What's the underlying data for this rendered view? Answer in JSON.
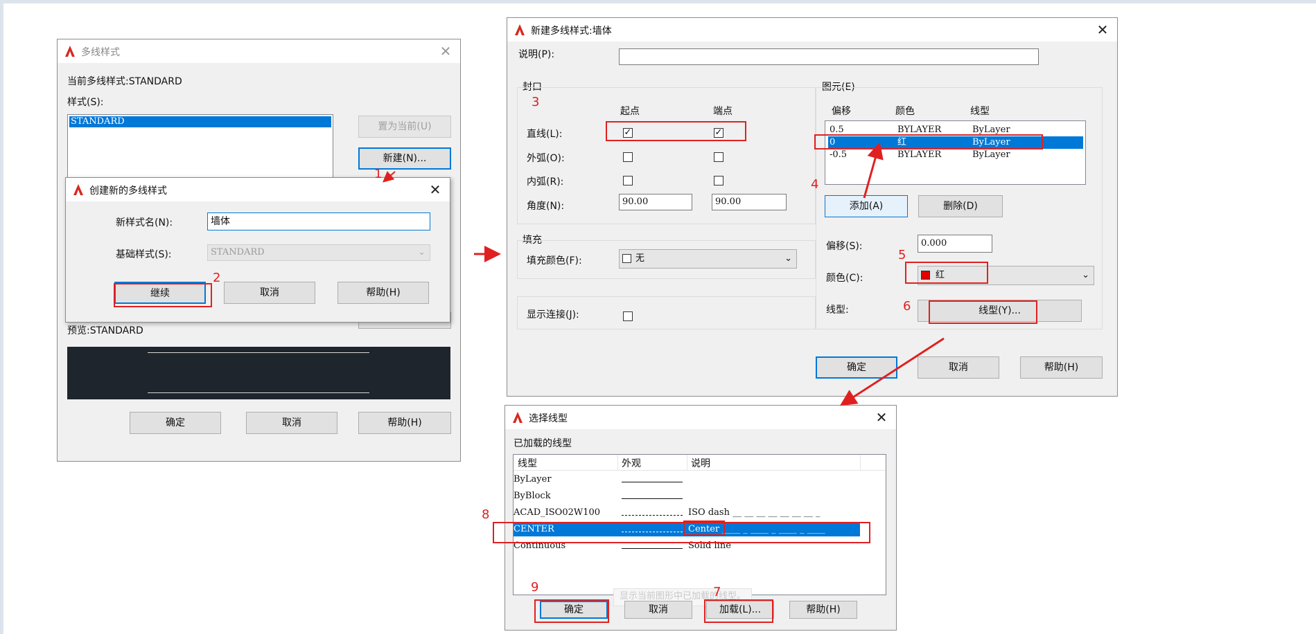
{
  "mls": {
    "title": "多线样式",
    "current_label": "当前多线样式:STANDARD",
    "styles_label": "样式(S):",
    "style_items": [
      "STANDARD"
    ],
    "set_current_btn": "置为当前(U)",
    "new_btn": "新建(N)...",
    "preview_label": "预览:STANDARD",
    "ok": "确定",
    "cancel": "取消",
    "help": "帮助(H)"
  },
  "create": {
    "title": "创建新的多线样式",
    "name_label": "新样式名(N):",
    "name_value": "墙体",
    "base_label": "基础样式(S):",
    "base_value": "STANDARD",
    "continue_btn": "继续",
    "cancel_btn": "取消",
    "help_btn": "帮助(H)"
  },
  "newstyle": {
    "title": "新建多线样式:墙体",
    "desc_label": "说明(P):",
    "desc_value": "",
    "caps": {
      "group_label": "封口",
      "start_label": "起点",
      "end_label": "端点",
      "line_label": "直线(L):",
      "outer_arc_label": "外弧(O):",
      "inner_arc_label": "内弧(R):",
      "angle_label": "角度(N):",
      "start_angle": "90.00",
      "end_angle": "90.00",
      "line_start_checked": true,
      "line_end_checked": true,
      "outer_start_checked": false,
      "outer_end_checked": false,
      "inner_start_checked": false,
      "inner_end_checked": false
    },
    "fill": {
      "group_label": "填充",
      "color_label": "填充颜色(F):",
      "color_value": "无"
    },
    "show_joints_label": "显示连接(J):",
    "elements": {
      "group_label": "图元(E)",
      "headers": [
        "偏移",
        "颜色",
        "线型"
      ],
      "rows": [
        {
          "offset": "0.5",
          "color": "BYLAYER",
          "linetype": "ByLayer",
          "selected": false
        },
        {
          "offset": "0",
          "color": "红",
          "linetype": "ByLayer",
          "selected": true
        },
        {
          "offset": "-0.5",
          "color": "BYLAYER",
          "linetype": "ByLayer",
          "selected": false
        }
      ],
      "add_btn": "添加(A)",
      "delete_btn": "删除(D)",
      "offset_label": "偏移(S):",
      "offset_value": "0.000",
      "color_label": "颜色(C):",
      "color_value": "红",
      "color_swatch": "#e00000",
      "linetype_label": "线型:",
      "linetype_btn": "线型(Y)..."
    },
    "ok": "确定",
    "cancel": "取消",
    "help": "帮助(H)"
  },
  "linetype": {
    "title": "选择线型",
    "loaded_label": "已加载的线型",
    "headers": [
      "线型",
      "外观",
      "说明"
    ],
    "rows": [
      {
        "name": "ByLayer",
        "appearance": "solid",
        "desc": ""
      },
      {
        "name": "ByBlock",
        "appearance": "solid",
        "desc": ""
      },
      {
        "name": "ACAD_ISO02W100",
        "appearance": "dash",
        "desc": "ISO dash __ __ __ __ __ __ __ _"
      },
      {
        "name": "CENTER",
        "appearance": "center",
        "desc": "Center ____ _ ____ _ ____ _ ____"
      },
      {
        "name": "Continuous",
        "appearance": "solid",
        "desc": "Solid line"
      }
    ],
    "selected_index": 3,
    "tooltip": "显示当前图形中已加载的线型。",
    "ok": "确定",
    "cancel": "取消",
    "load": "加载(L)...",
    "help": "帮助(H)"
  },
  "steps": [
    "1",
    "2",
    "3",
    "4",
    "5",
    "6",
    "7",
    "8",
    "9"
  ],
  "colors": {
    "annotation": "#e02020",
    "selection": "#0078d7",
    "preview_bg": "#1f252d"
  }
}
